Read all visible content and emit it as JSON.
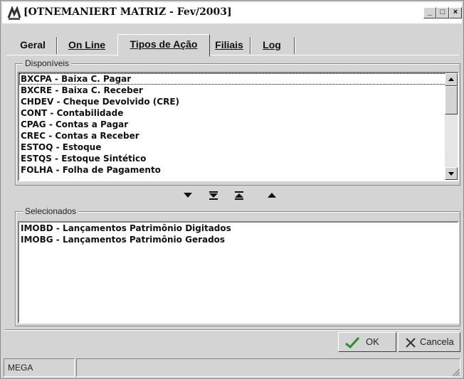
{
  "window": {
    "title": "[OTNEMANIERT MATRIZ - Fev/2003]"
  },
  "title_buttons": {
    "minimize": "_",
    "maximize": "□",
    "close": "×"
  },
  "tabs": [
    {
      "label": "Geral"
    },
    {
      "label": "On Line"
    },
    {
      "label": "Tipos de Ação"
    },
    {
      "label": "Filiais"
    },
    {
      "label": "Log"
    }
  ],
  "active_tab": "Tipos de Ação",
  "available": {
    "label": "Disponíveis",
    "items": [
      "BXCPA - Baixa C. Pagar",
      "BXCRE - Baixa C. Receber",
      "CHDEV - Cheque Devolvido (CRE)",
      "CONT - Contabilidade",
      "CPAG - Contas a Pagar",
      "CREC - Contas a Receber",
      "ESTOQ - Estoque",
      "ESTQS - Estoque Sintético",
      "FOLHA - Folha de Pagamento"
    ]
  },
  "selected": {
    "label": "Selecionados",
    "items": [
      "IMOBD - Lançamentos Patrimônio Digitados",
      "IMOBG - Lançamentos Patrimônio Gerados"
    ]
  },
  "buttons": {
    "ok": "OK",
    "cancel": "Cancela"
  },
  "status": {
    "panel1": "MEGA",
    "panel2": ""
  },
  "colors": {
    "window_bg": "#d4d4d4",
    "list_bg": "#ffffff",
    "ok_check": "#2e8b2e"
  }
}
